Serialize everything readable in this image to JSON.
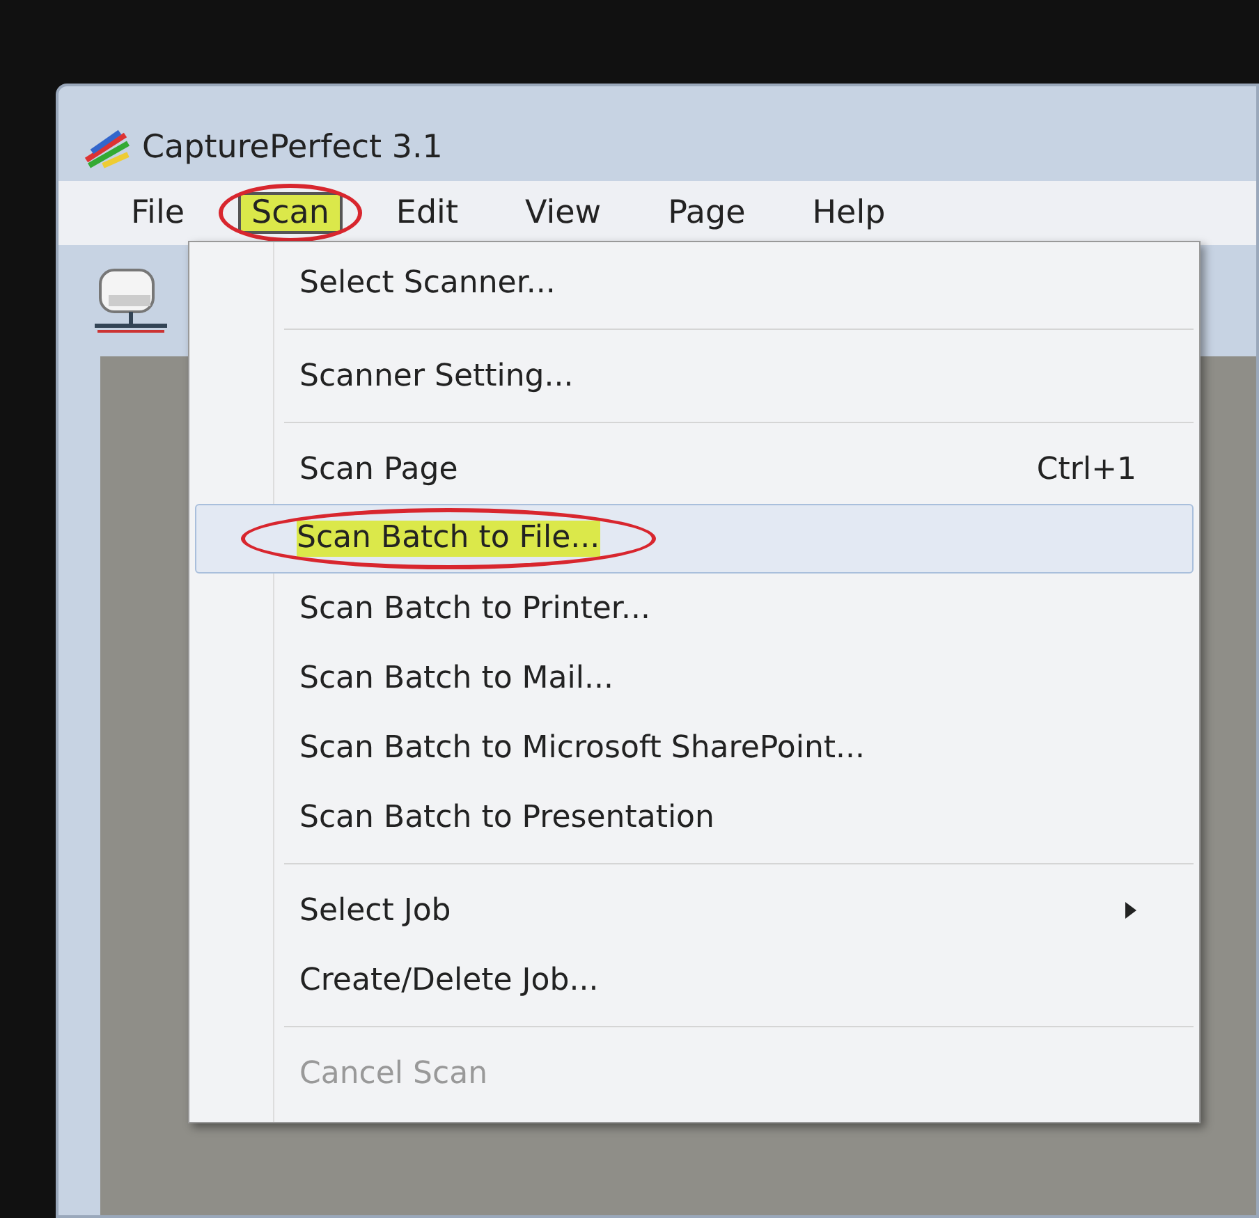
{
  "window": {
    "title": "CapturePerfect 3.1"
  },
  "menu_bar": [
    {
      "label": "File",
      "selected": false,
      "highlighted": false,
      "circled": false
    },
    {
      "label": "Scan",
      "selected": true,
      "highlighted": true,
      "circled": true
    },
    {
      "label": "Edit",
      "selected": false,
      "highlighted": false,
      "circled": false
    },
    {
      "label": "View",
      "selected": false,
      "highlighted": false,
      "circled": false
    },
    {
      "label": "Page",
      "selected": false,
      "highlighted": false,
      "circled": false
    },
    {
      "label": "Help",
      "selected": false,
      "highlighted": false,
      "circled": false
    }
  ],
  "menu": [
    {
      "kind": "item",
      "label": "Select Scanner...",
      "selected": false,
      "disabled": false,
      "highlighted": false,
      "circled": false
    },
    {
      "kind": "separator"
    },
    {
      "kind": "item",
      "label": "Scanner Setting...",
      "selected": false,
      "disabled": false,
      "highlighted": false,
      "circled": false
    },
    {
      "kind": "separator"
    },
    {
      "kind": "item",
      "label": "Scan Page",
      "shortcut": "Ctrl+1",
      "selected": false,
      "disabled": false,
      "highlighted": false,
      "circled": false
    },
    {
      "kind": "item",
      "label": "Scan Batch to File...",
      "selected": true,
      "disabled": false,
      "highlighted": true,
      "circled": true
    },
    {
      "kind": "item",
      "label": "Scan Batch to Printer...",
      "selected": false,
      "disabled": false,
      "highlighted": false,
      "circled": false
    },
    {
      "kind": "item",
      "label": "Scan Batch to Mail...",
      "selected": false,
      "disabled": false,
      "highlighted": false,
      "circled": false
    },
    {
      "kind": "item",
      "label": "Scan Batch to Microsoft SharePoint...",
      "selected": false,
      "disabled": false,
      "highlighted": false,
      "circled": false
    },
    {
      "kind": "item",
      "label": "Scan Batch to Presentation",
      "selected": false,
      "disabled": false,
      "highlighted": false,
      "circled": false
    },
    {
      "kind": "separator"
    },
    {
      "kind": "item",
      "label": "Select Job",
      "submenu": true,
      "selected": false,
      "disabled": false,
      "highlighted": false,
      "circled": false
    },
    {
      "kind": "item",
      "label": "Create/Delete Job...",
      "selected": false,
      "disabled": false,
      "highlighted": false,
      "circled": false
    },
    {
      "kind": "separator"
    },
    {
      "kind": "item",
      "label": "Cancel Scan",
      "selected": false,
      "disabled": true,
      "highlighted": false,
      "circled": false
    }
  ]
}
